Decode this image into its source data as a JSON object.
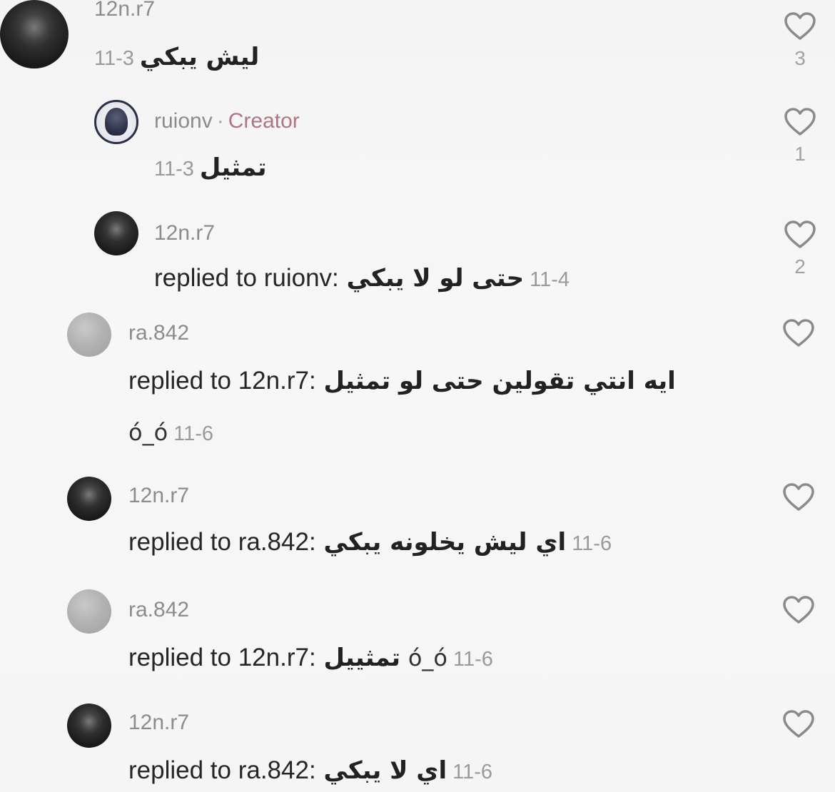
{
  "comments": [
    {
      "username": "12n.r7",
      "text": "ليش يبكي",
      "date": "11-3",
      "likes": "3"
    },
    {
      "username": "ruionv",
      "separator": "·",
      "badge": "Creator",
      "text": "تمثيل",
      "date": "11-3",
      "likes": "1"
    },
    {
      "username": "12n.r7",
      "reply_prefix": "replied to ruionv:",
      "text": "حتى لو لا يبكي",
      "date": "11-4",
      "likes": "2"
    },
    {
      "username": "ra.842",
      "reply_prefix": "replied to 12n.r7:",
      "text": "ايه انتي تقولين حتى لو تمثيل",
      "emoticon": "ó_ó",
      "date": "11-6"
    },
    {
      "username": "12n.r7",
      "reply_prefix": "replied to ra.842:",
      "text": "اي ليش يخلونه يبكي",
      "date": "11-6"
    },
    {
      "username": "ra.842",
      "reply_prefix": "replied to 12n.r7:",
      "text": "تمثييل",
      "emoticon": "ó_ó",
      "date": "11-6"
    },
    {
      "username": "12n.r7",
      "reply_prefix": "replied to ra.842:",
      "text": "اي لا يبكي",
      "date": "11-6"
    }
  ],
  "icons": {
    "like": "heart-outline-icon"
  },
  "colors": {
    "background": "#f6f6f6",
    "username": "#8c8c8c",
    "creator_badge": "#b07582",
    "date": "#9a9a9a",
    "text": "#262626"
  }
}
